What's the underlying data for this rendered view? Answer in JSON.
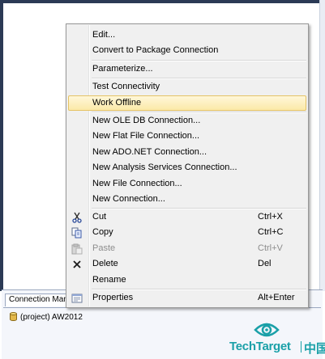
{
  "context_menu": {
    "items": [
      {
        "label": "Edit...",
        "shortcut": "",
        "enabled": true
      },
      {
        "label": "Convert to Package Connection",
        "shortcut": "",
        "enabled": true
      },
      {
        "label": "Parameterize...",
        "shortcut": "",
        "enabled": true
      },
      {
        "label": "Test Connectivity",
        "shortcut": "",
        "enabled": true
      },
      {
        "label": "Work Offline",
        "shortcut": "",
        "enabled": true,
        "highlighted": true
      },
      {
        "label": "New OLE DB Connection...",
        "shortcut": "",
        "enabled": true
      },
      {
        "label": "New Flat File Connection...",
        "shortcut": "",
        "enabled": true
      },
      {
        "label": "New ADO.NET Connection...",
        "shortcut": "",
        "enabled": true
      },
      {
        "label": "New Analysis Services Connection...",
        "shortcut": "",
        "enabled": true
      },
      {
        "label": "New File Connection...",
        "shortcut": "",
        "enabled": true
      },
      {
        "label": "New Connection...",
        "shortcut": "",
        "enabled": true
      },
      {
        "label": "Cut",
        "shortcut": "Ctrl+X",
        "enabled": true,
        "icon": "scissors-icon"
      },
      {
        "label": "Copy",
        "shortcut": "Ctrl+C",
        "enabled": true,
        "icon": "copy-icon"
      },
      {
        "label": "Paste",
        "shortcut": "Ctrl+V",
        "enabled": false,
        "icon": "paste-icon"
      },
      {
        "label": "Delete",
        "shortcut": "Del",
        "enabled": true,
        "icon": "delete-x-icon"
      },
      {
        "label": "Rename",
        "shortcut": "",
        "enabled": true
      },
      {
        "label": "Properties",
        "shortcut": "Alt+Enter",
        "enabled": true,
        "icon": "properties-icon"
      }
    ]
  },
  "tray": {
    "tab_label": "Connection Managers",
    "connection_item": "(project) AW2012"
  },
  "watermark": {
    "brand": "TechTarget",
    "region": "中国"
  },
  "colors": {
    "highlight_border": "#e5c365",
    "brand_teal": "#1aa0a8",
    "disabled_text": "#8d8d8d"
  }
}
